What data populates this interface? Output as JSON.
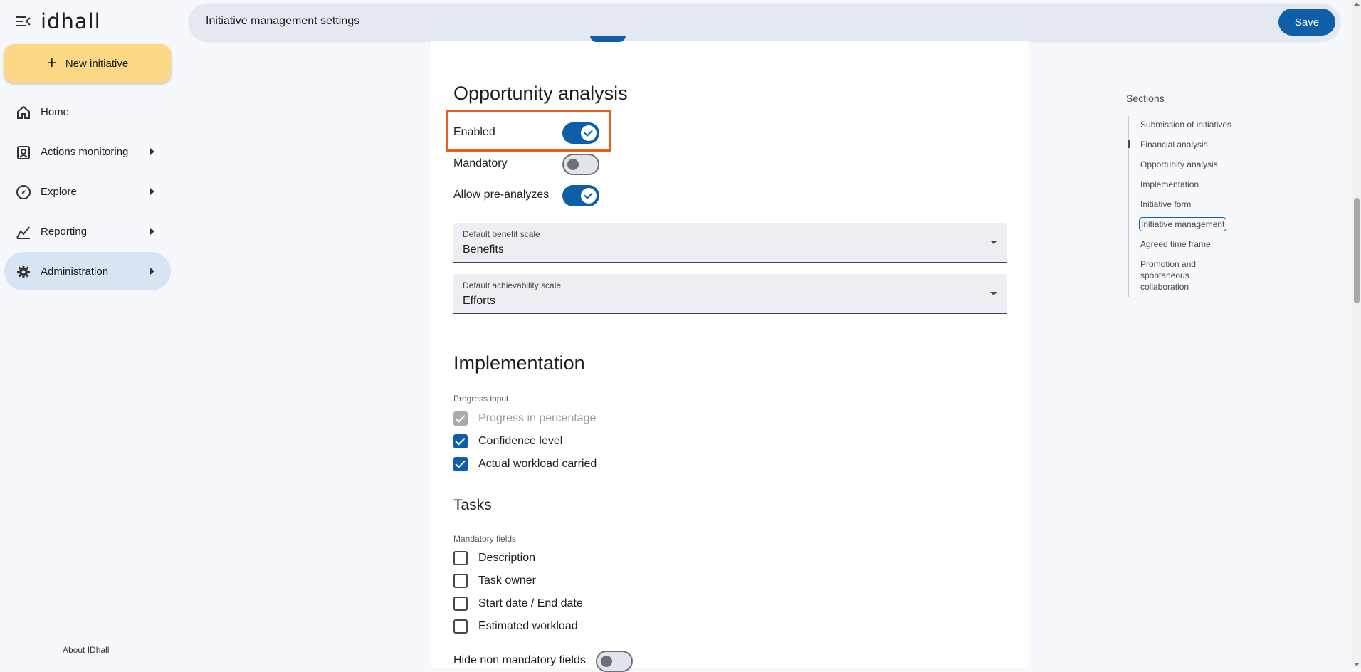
{
  "brand": {
    "logo_text": "idhall"
  },
  "nav": {
    "new_initiative": "New initiative",
    "items": [
      {
        "label": "Home",
        "icon": "home-icon"
      },
      {
        "label": "Actions monitoring",
        "icon": "clipboard-user-icon"
      },
      {
        "label": "Explore",
        "icon": "compass-icon"
      },
      {
        "label": "Reporting",
        "icon": "chart-line-icon"
      },
      {
        "label": "Administration",
        "icon": "gear-icon"
      }
    ],
    "about": "About IDhall"
  },
  "topbar": {
    "title": "Initiative management settings",
    "save_label": "Save"
  },
  "opportunity": {
    "heading": "Opportunity analysis",
    "enabled_label": "Enabled",
    "enabled": true,
    "mandatory_label": "Mandatory",
    "mandatory": false,
    "allow_pre_label": "Allow pre-analyzes",
    "allow_pre": true,
    "benefit_caption": "Default benefit scale",
    "benefit_value": "Benefits",
    "achievability_caption": "Default achievability scale",
    "achievability_value": "Efforts"
  },
  "implementation": {
    "heading": "Implementation",
    "progress_input_label": "Progress input",
    "options": [
      {
        "label": "Progress in percentage",
        "state": "checked-disabled"
      },
      {
        "label": "Confidence level",
        "state": "checked"
      },
      {
        "label": "Actual workload carried",
        "state": "checked"
      }
    ]
  },
  "tasks": {
    "heading": "Tasks",
    "mandatory_fields_label": "Mandatory fields",
    "fields": [
      {
        "label": "Description",
        "checked": false
      },
      {
        "label": "Task owner",
        "checked": false
      },
      {
        "label": "Start date / End date",
        "checked": false
      },
      {
        "label": "Estimated workload",
        "checked": false
      }
    ],
    "hide_non_mandatory_label": "Hide non mandatory fields",
    "hide_non_mandatory": false
  },
  "sections": {
    "title": "Sections",
    "items": [
      "Submission of initiatives",
      "Financial analysis",
      "Opportunity analysis",
      "Implementation",
      "Initiative form",
      "Initiative management",
      "Agreed time frame",
      "Promotion and spontaneous collaboration"
    ],
    "current": "Initiative management"
  },
  "colors": {
    "accent": "#0f5fa8",
    "highlight": "#f05a1a",
    "new_button": "#fbd786"
  }
}
